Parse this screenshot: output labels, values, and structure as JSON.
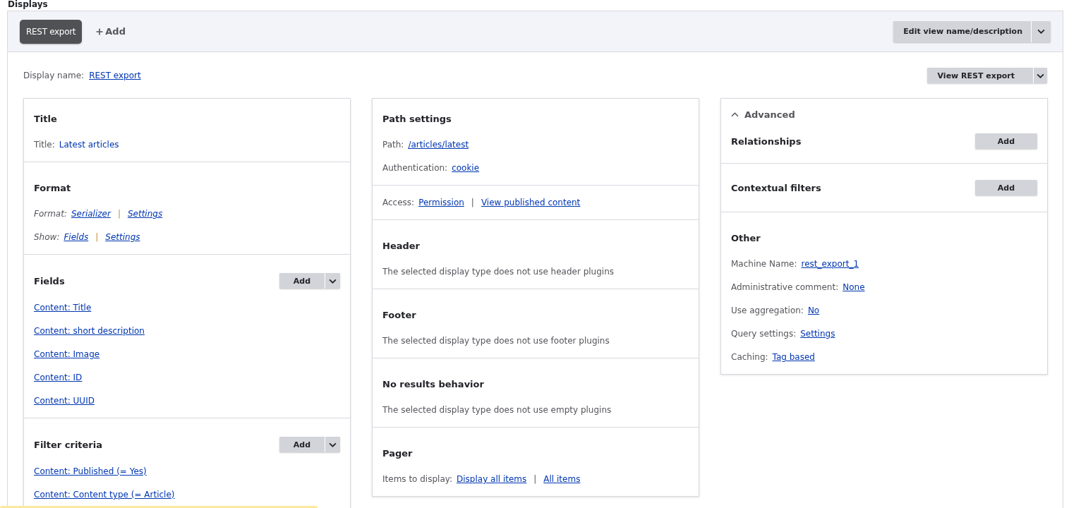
{
  "heading": "Displays",
  "display_tabs": [
    {
      "label": "REST export",
      "selected": true
    }
  ],
  "add_display": {
    "label": "Add"
  },
  "edit_button": {
    "label": "Edit view name/description"
  },
  "display_name": {
    "label": "Display name:",
    "value": "REST export"
  },
  "view_button": {
    "label": "View REST export"
  },
  "columns": [
    {
      "sections": [
        {
          "title": "Title",
          "lines": [
            {
              "kind": "value",
              "label": "Title:",
              "value": "Latest articles"
            }
          ]
        },
        {
          "title": "Format",
          "lines": [
            {
              "kind": "setting",
              "italic": true,
              "label": "Format:",
              "links": [
                "Serializer",
                "Settings"
              ],
              "separator": "|"
            },
            {
              "kind": "setting",
              "italic": true,
              "label": "Show:",
              "links": [
                "Fields",
                "Settings"
              ],
              "separator": "|"
            }
          ]
        },
        {
          "title": "Fields",
          "add_button": {
            "label": "Add",
            "kind": "split"
          },
          "lines": [
            {
              "kind": "link",
              "text": "Content: Title"
            },
            {
              "kind": "link",
              "text": "Content: short description"
            },
            {
              "kind": "link",
              "text": "Content: Image"
            },
            {
              "kind": "link",
              "text": "Content: ID"
            },
            {
              "kind": "link",
              "text": "Content: UUID"
            }
          ]
        },
        {
          "title": "Filter criteria",
          "add_button": {
            "label": "Add",
            "kind": "split"
          },
          "lines": [
            {
              "kind": "link",
              "text": "Content: Published (= Yes)"
            },
            {
              "kind": "link",
              "text": "Content: Content type (= Article)"
            }
          ]
        }
      ]
    },
    {
      "sections": [
        {
          "title": "Path settings",
          "lines": [
            {
              "kind": "setting",
              "italic": false,
              "label": "Path:",
              "links": [
                "/articles/latest"
              ]
            },
            {
              "kind": "setting",
              "italic": false,
              "label": "Authentication:",
              "links": [
                "cookie"
              ]
            }
          ]
        },
        {
          "lines": [
            {
              "kind": "setting",
              "italic": false,
              "label": "Access:",
              "links": [
                "Permission",
                "View published content"
              ],
              "separator": "|"
            }
          ]
        },
        {
          "title": "Header",
          "lines": [
            {
              "kind": "note",
              "text": "The selected display type does not use header plugins"
            }
          ]
        },
        {
          "title": "Footer",
          "lines": [
            {
              "kind": "note",
              "text": "The selected display type does not use footer plugins"
            }
          ]
        },
        {
          "title": "No results behavior",
          "lines": [
            {
              "kind": "note",
              "text": "The selected display type does not use empty plugins"
            }
          ]
        },
        {
          "title": "Pager",
          "lines": [
            {
              "kind": "setting",
              "italic": false,
              "label": "Items to display:",
              "links": [
                "Display all items",
                "All items"
              ],
              "separator": "|"
            }
          ]
        }
      ]
    },
    {
      "collapsible": {
        "label": "Advanced",
        "expanded": true
      },
      "sections": [
        {
          "title": "Relationships",
          "add_button": {
            "label": "Add",
            "kind": "plain"
          }
        },
        {
          "title": "Contextual filters",
          "add_button": {
            "label": "Add",
            "kind": "plain"
          }
        },
        {
          "title": "Other",
          "lines": [
            {
              "kind": "setting",
              "italic": false,
              "label": "Machine Name:",
              "links": [
                "rest_export_1"
              ]
            },
            {
              "kind": "setting",
              "italic": false,
              "label": "Administrative comment:",
              "links": [
                "None"
              ]
            },
            {
              "kind": "setting",
              "italic": false,
              "label": "Use aggregation:",
              "links": [
                "No"
              ]
            },
            {
              "kind": "setting",
              "italic": false,
              "label": "Query settings:",
              "links": [
                "Settings"
              ]
            },
            {
              "kind": "setting",
              "italic": false,
              "label": "Caching:",
              "links": [
                "Tag based"
              ]
            }
          ]
        }
      ]
    }
  ]
}
